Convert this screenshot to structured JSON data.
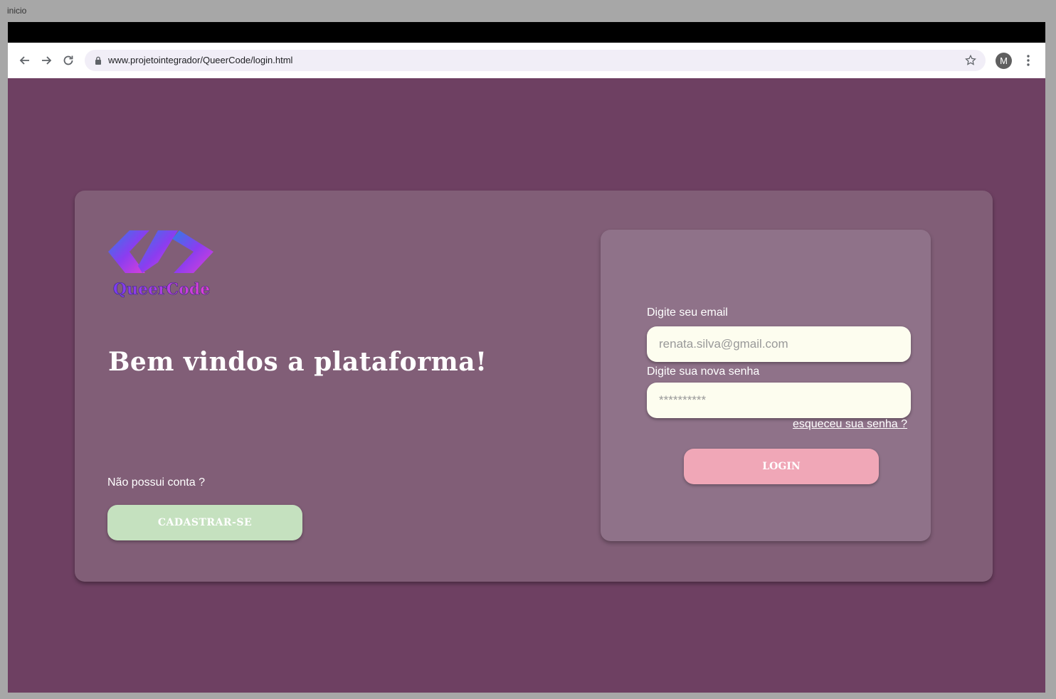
{
  "window": {
    "title": "inicio"
  },
  "browser": {
    "url": "www.projetointegrador/QueerCode/login.html",
    "profile_initial": "M"
  },
  "page": {
    "logo_text": "QueerCode",
    "welcome": "Bem vindos a plataforma!",
    "no_account_text": "Não possui conta ?",
    "signup_label": "CADASTRAR-SE",
    "login_form": {
      "email_label": "Digite seu email",
      "email_placeholder": "renata.silva@gmail.com",
      "password_label": "Digite sua nova senha",
      "password_placeholder": "**********",
      "forgot_link": "esqueceu sua senha ?",
      "login_label": "LOGIN"
    }
  },
  "colors": {
    "page_bg": "#6e4062",
    "card_bg": "#815e77",
    "panel_bg": "#8f7289",
    "signup_btn": "#c5e1bf",
    "login_btn": "#f0a7b7",
    "input_bg": "#fdfdef"
  },
  "icons": {
    "back": "arrow-left-icon",
    "forward": "arrow-right-icon",
    "reload": "reload-icon",
    "lock": "lock-icon",
    "bookmark": "star-icon",
    "menu": "more-vert-icon"
  }
}
